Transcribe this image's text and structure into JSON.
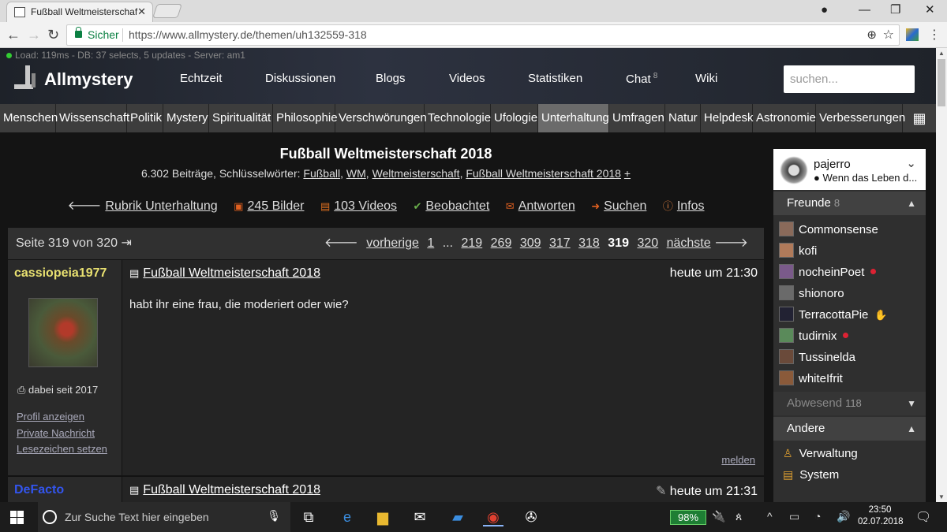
{
  "browser": {
    "tab_title": "Fußball Weltmeisterschaf",
    "secure_label": "Sicher",
    "url": "https://www.allmystery.de/themen/uh132559-318"
  },
  "header": {
    "load_info": "Load: 119ms - DB: 37 selects, 5 updates - Server: am1",
    "brand": "Allmystery",
    "nav": [
      {
        "label": "Echtzeit"
      },
      {
        "label": "Diskussionen"
      },
      {
        "label": "Blogs"
      },
      {
        "label": "Videos"
      },
      {
        "label": "Statistiken"
      },
      {
        "label": "Chat",
        "badge": "8"
      },
      {
        "label": "Wiki"
      }
    ],
    "search_placeholder": "suchen..."
  },
  "categories": [
    "Menschen",
    "Wissenschaft",
    "Politik",
    "Mystery",
    "Spiritualität",
    "Philosophie",
    "Verschwörungen",
    "Technologie",
    "Ufologie",
    "Unterhaltung",
    "Umfragen",
    "Natur",
    "Helpdesk",
    "Astronomie",
    "Verbesserungen"
  ],
  "active_category": "Unterhaltung",
  "thread": {
    "title": "Fußball Weltmeisterschaft 2018",
    "meta_prefix": "6.302 Beiträge, Schlüsselwörter:",
    "keywords": [
      "Fußball",
      "WM",
      "Weltmeisterschaft",
      "Fußball Weltmeisterschaft 2018"
    ],
    "keywords_more": "+",
    "actions": [
      {
        "icon": "arrow-left-icon",
        "label": "Rubrik Unterhaltung"
      },
      {
        "icon": "images-icon",
        "label": "245 Bilder"
      },
      {
        "icon": "video-icon",
        "label": "103 Videos"
      },
      {
        "icon": "watch-icon",
        "label": "Beobachtet"
      },
      {
        "icon": "reply-icon",
        "label": "Antworten"
      },
      {
        "icon": "search-icon",
        "label": "Suchen"
      },
      {
        "icon": "info-icon",
        "label": "Infos"
      }
    ]
  },
  "pager": {
    "page_label": "Seite 319 von 320",
    "prev": "vorherige",
    "pages": [
      "1",
      "...",
      "219",
      "269",
      "309",
      "317",
      "318"
    ],
    "current": "319",
    "after": [
      "320"
    ],
    "next": "nächste"
  },
  "posts": [
    {
      "author": "cassiopeia1977",
      "author_color": "#e8e070",
      "since": "dabei seit 2017",
      "links": [
        "Profil anzeigen",
        "Private Nachricht",
        "Lesezeichen setzen"
      ],
      "title": "Fußball Weltmeisterschaft 2018",
      "time": "heute um 21:30",
      "text": "habt ihr eine frau, die moderiert oder wie?",
      "report": "melden"
    },
    {
      "author": "DeFacto",
      "author_color": "#3355ee",
      "title": "Fußball Weltmeisterschaft 2018",
      "time": "heute um 21:31"
    }
  ],
  "sidebar": {
    "user": {
      "name": "pajerro",
      "status": "● Wenn das Leben d..."
    },
    "friends_label": "Freunde",
    "friends_count": "8",
    "friends": [
      {
        "name": "Commonsense",
        "online": false,
        "color": "#8a6a5a"
      },
      {
        "name": "kofi",
        "online": false,
        "color": "#b07a5a"
      },
      {
        "name": "nocheinPoet",
        "online": true,
        "color": "#7a5a8a"
      },
      {
        "name": "shionoro",
        "online": false,
        "color": "#6a6a6a"
      },
      {
        "name": "TerracottaPie",
        "online": false,
        "hand": true,
        "color": "#222233"
      },
      {
        "name": "tudirnix",
        "online": true,
        "color": "#5a8a5a"
      },
      {
        "name": "Tussinelda",
        "online": false,
        "color": "#6a4a3a"
      },
      {
        "name": "whiteIfrit",
        "online": false,
        "color": "#8a5a3a"
      }
    ],
    "absent_label": "Abwesend",
    "absent_count": "118",
    "other_label": "Andere",
    "other": [
      {
        "icon": "admin-icon",
        "label": "Verwaltung"
      },
      {
        "icon": "system-icon",
        "label": "System"
      }
    ]
  },
  "taskbar": {
    "search_placeholder": "Zur Suche Text hier eingeben",
    "battery": "98%",
    "time": "23:50",
    "date": "02.07.2018"
  }
}
